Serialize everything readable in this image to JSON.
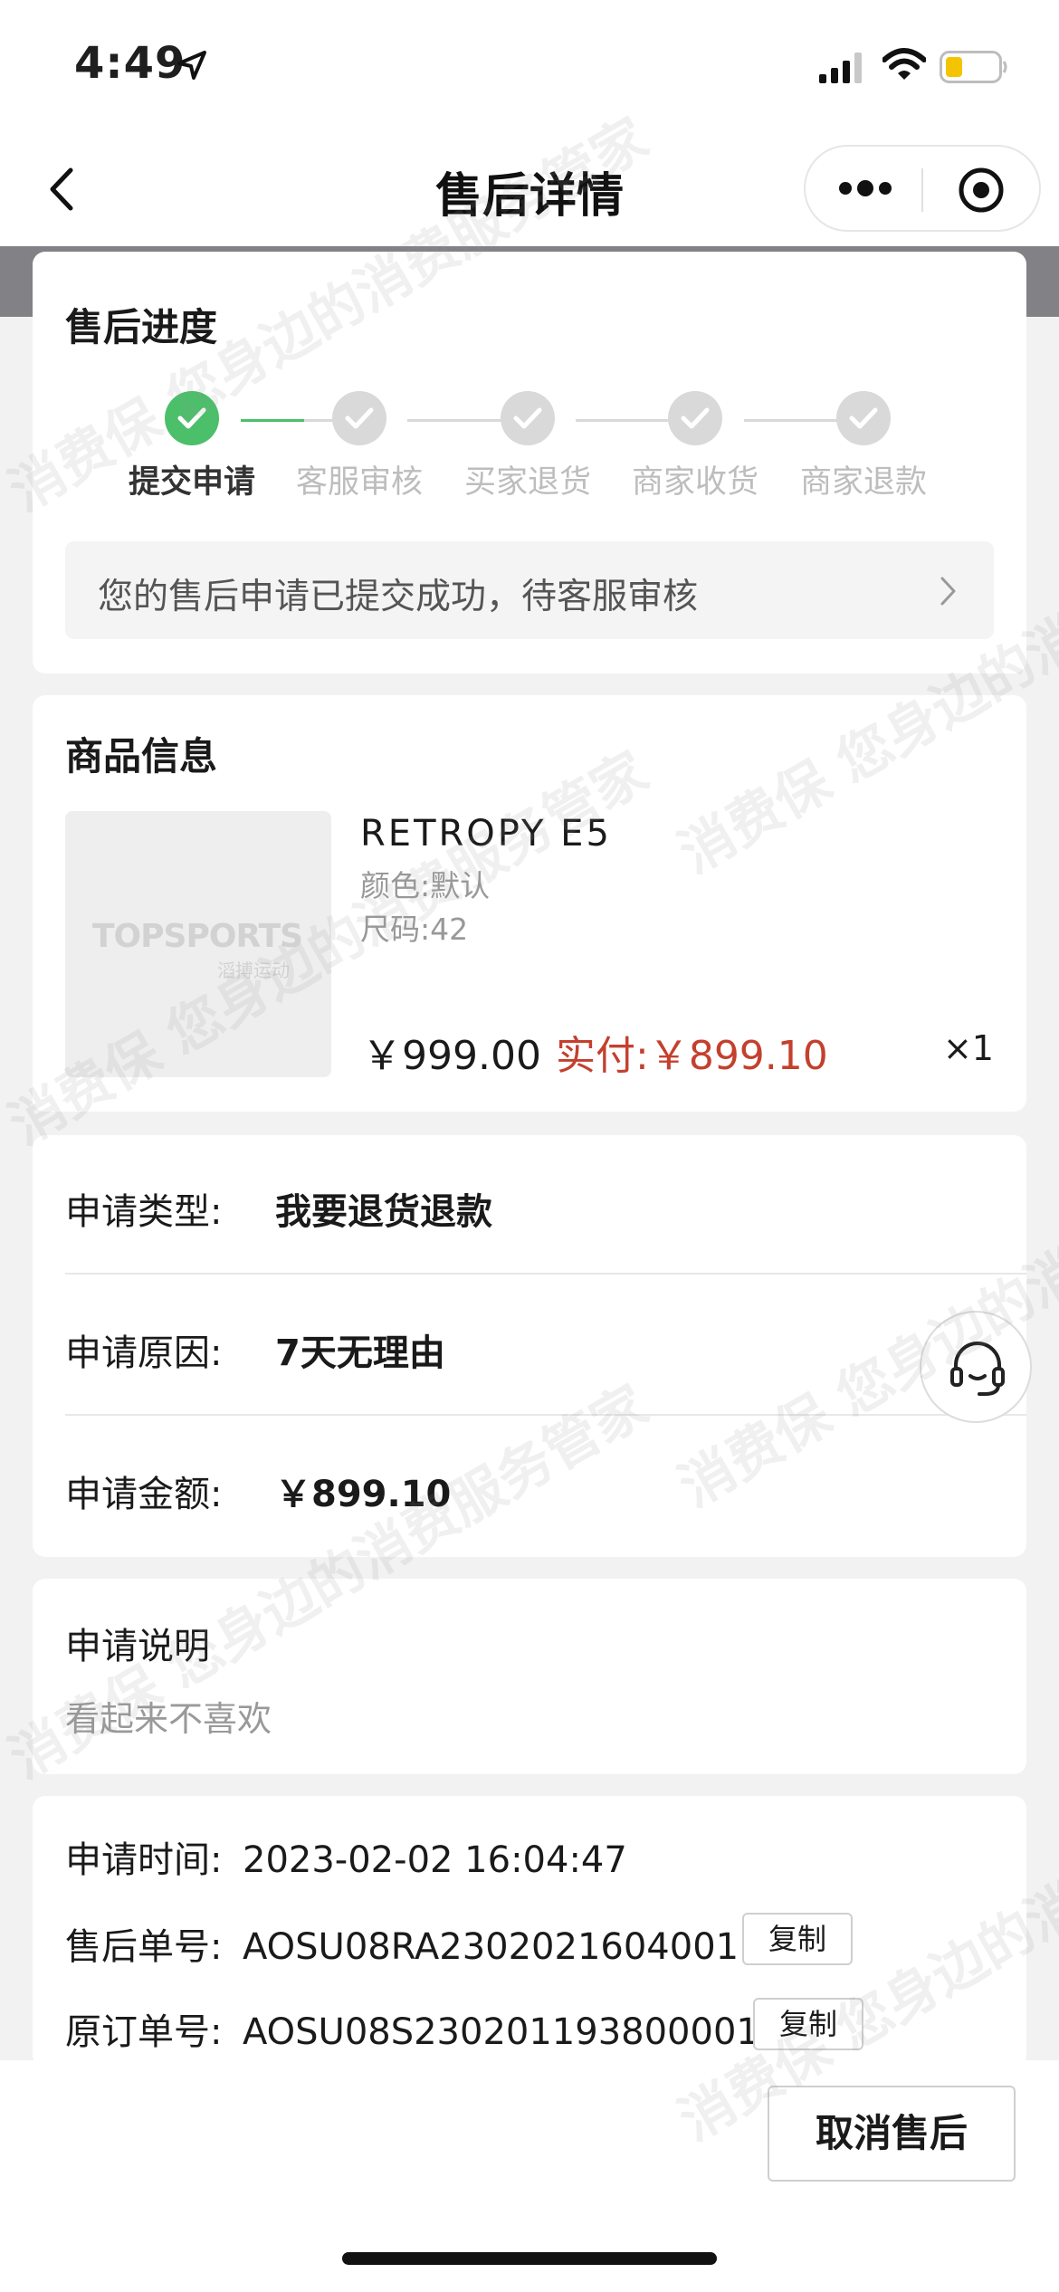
{
  "status_bar": {
    "time": "4:49"
  },
  "nav": {
    "title": "售后详情"
  },
  "progress": {
    "title": "售后进度",
    "steps": [
      {
        "label": "提交申请",
        "done": true
      },
      {
        "label": "客服审核",
        "done": false
      },
      {
        "label": "买家退货",
        "done": false
      },
      {
        "label": "商家收货",
        "done": false
      },
      {
        "label": "商家退款",
        "done": false
      }
    ],
    "notice": "您的售后申请已提交成功，待客服审核"
  },
  "goods": {
    "title": "商品信息",
    "image_logo": "TOPSPORTS",
    "image_logo_sub": "滔搏运动",
    "name": "RETROPY E5",
    "color": "颜色:默认",
    "size": "尺码:42",
    "price_original": "￥999.00",
    "price_paid": "实付:￥899.10",
    "quantity": "×1"
  },
  "request": {
    "type_label": "申请类型:",
    "type_value": "我要退货退款",
    "reason_label": "申请原因:",
    "reason_value": "7天无理由",
    "amount_label": "申请金额:",
    "amount_value": "￥899.10"
  },
  "note": {
    "title": "申请说明",
    "value": "看起来不喜欢"
  },
  "order": {
    "time_label": "申请时间:",
    "time_value": "2023-02-02 16:04:47",
    "aftersale_label": "售后单号:",
    "aftersale_value": "AOSU08RA2302021604001",
    "original_label": "原订单号:",
    "original_value": "AOSU08S230201193800001",
    "copy_label": "复制"
  },
  "actions": {
    "cancel_label": "取消售后"
  },
  "watermark": {
    "text": "消费保 您身边的消费服务管家"
  },
  "colors": {
    "accent_green": "#4cbf6a",
    "price_red": "#c4402d"
  }
}
